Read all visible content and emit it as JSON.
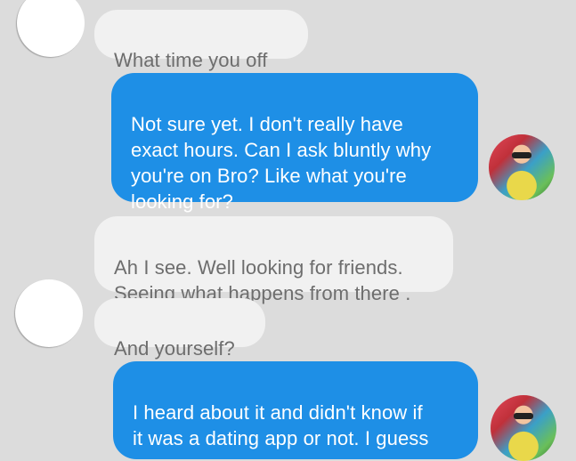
{
  "conversation": {
    "messages": [
      {
        "direction": "incoming",
        "text": "What time you off"
      },
      {
        "direction": "outgoing",
        "text": "Not sure yet. I don't really have\nexact hours. Can I ask bluntly why\nyou're on Bro? Like what you're\nlooking for?"
      },
      {
        "direction": "incoming",
        "text": "Ah I see. Well looking for friends.\nSeeing what happens from there ."
      },
      {
        "direction": "incoming",
        "text": "And yourself?"
      },
      {
        "direction": "outgoing",
        "text": "I heard about it and didn't know if\nit was a dating app or not. I guess"
      }
    ]
  },
  "colors": {
    "background": "#dcdcdc",
    "incoming_bubble": "#f1f1f1",
    "incoming_text": "#6d6d6d",
    "outgoing_bubble": "#1e8fe6",
    "outgoing_text": "#ffffff"
  }
}
